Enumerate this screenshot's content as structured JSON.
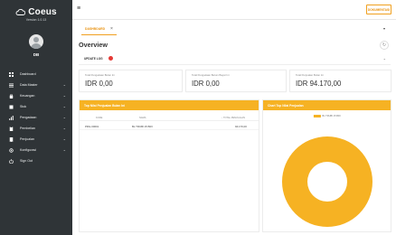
{
  "brand": {
    "name": "Coeus",
    "version": "Version 1.0.13"
  },
  "user": {
    "initials": "DB"
  },
  "sidebar": {
    "items": [
      {
        "label": "Dashboard",
        "icon": "grid-icon",
        "has_children": false
      },
      {
        "label": "Data Master",
        "icon": "list-icon",
        "has_children": true
      },
      {
        "label": "Keuangan",
        "icon": "bag-icon",
        "has_children": true
      },
      {
        "label": "Stok",
        "icon": "box-icon",
        "has_children": true
      },
      {
        "label": "Pengadaan",
        "icon": "bar-chart-icon",
        "has_children": true
      },
      {
        "label": "Pembelian",
        "icon": "clipboard-icon",
        "has_children": true
      },
      {
        "label": "Penjualan",
        "icon": "receipt-icon",
        "has_children": true
      },
      {
        "label": "Konfigurasi",
        "icon": "settings-icon",
        "has_children": true
      },
      {
        "label": "Sign Out",
        "icon": "power-icon",
        "has_children": false
      }
    ]
  },
  "topbar": {
    "doc_button": "DOKUMENTASI"
  },
  "tabs": [
    {
      "label": "DASHBOARD",
      "active": true
    }
  ],
  "overview": {
    "title": "Overview",
    "update_label": "UPDATE LOG"
  },
  "cards": [
    {
      "caption": "Total Pengadaan Bulan Ini",
      "value": "IDR 0,00"
    },
    {
      "caption": "Total Pengadaan Belum Bayar Ini",
      "value": "IDR 0,00"
    },
    {
      "caption": "Total Penjualan Bulan Ini",
      "value": "IDR 94.170,00"
    }
  ],
  "top_sales": {
    "title": "Top Nilai Penjualan Bulan Ini",
    "columns": [
      "KODE",
      "NAMA",
      "↓ TOTAL PENJUALAN"
    ],
    "rows": [
      [
        "PRG-00001",
        "BL TRUBI 15 BRI",
        "94.170,00"
      ]
    ]
  },
  "chart_panel": {
    "title": "Chart Top Nilai Penjualan"
  },
  "chart_data": {
    "type": "pie",
    "labels": [
      "BL TRUBI 15 BRI"
    ],
    "values": [
      94170
    ],
    "donut": true,
    "legend": "top",
    "title": "",
    "colors": [
      "#f6b223"
    ]
  },
  "colors": {
    "accent": "#f6b223",
    "accent_text": "#e8900c",
    "sidebar": "#2f3437",
    "badge": "#e53935"
  }
}
